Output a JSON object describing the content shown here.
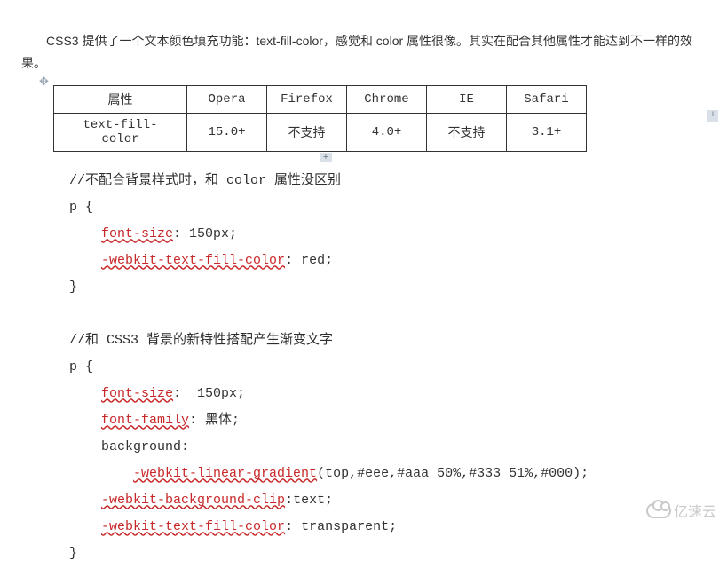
{
  "intro": {
    "text": "CSS3 提供了一个文本颜色填充功能：text-fill-color，感觉和 color 属性很像。其实在配合其他属性才能达到不一样的效果。"
  },
  "table": {
    "headers": [
      "属性",
      "Opera",
      "Firefox",
      "Chrome",
      "IE",
      "Safari"
    ],
    "rows": [
      [
        "text-fill-color",
        "15.0+",
        "不支持",
        "4.0+",
        "不支持",
        "3.1+"
      ]
    ],
    "handle_row": "+",
    "handle_col": "+",
    "drag": "✥"
  },
  "code": {
    "comment1": "//不配合背景样式时，和 color 属性没区别",
    "p1_open": "p {",
    "p1_l1a": "font-size",
    "p1_l1b": ": 150px;",
    "p1_l2a": "-webkit-text-fill-color",
    "p1_l2b": ": red;",
    "p1_close": "}",
    "blank": "",
    "comment2": "//和 CSS3 背景的新特性搭配产生渐变文字",
    "p2_open": "p {",
    "p2_l1a": "font-size",
    "p2_l1b": ":  150px;",
    "p2_l2a": "font-family",
    "p2_l2b": ": 黑体;",
    "p2_l3": "background:",
    "p2_l4a": "-webkit-linear-gradient",
    "p2_l4b": "(top,#eee,#aaa 50%,#333 51%,#000);",
    "p2_l5a": "-webkit-background-clip",
    "p2_l5b": ":text;",
    "p2_l6a": "-webkit-text-fill-color",
    "p2_l6b": ": transparent;",
    "p2_close": "}"
  },
  "watermark": "亿速云"
}
